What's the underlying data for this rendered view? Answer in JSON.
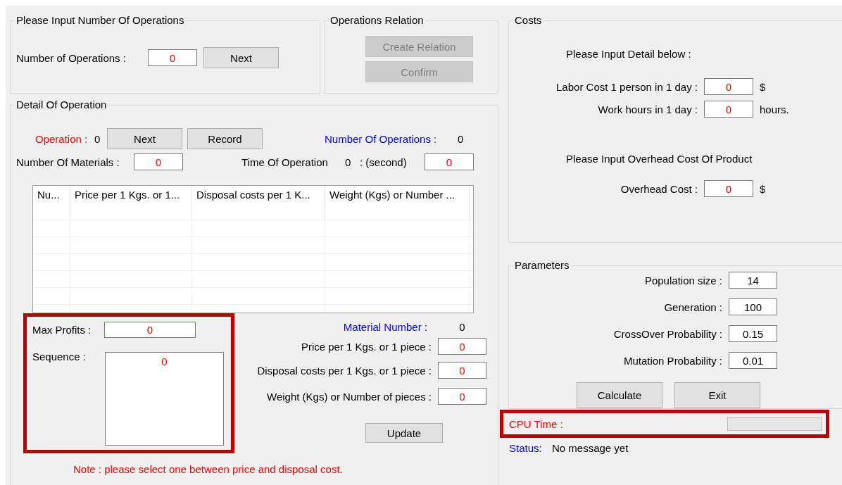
{
  "operations_input": {
    "title": "Please Input Number Of Operations",
    "label": "Number of Operations :",
    "value": "0",
    "next_button": "Next"
  },
  "operations_relation": {
    "title": "Operations Relation",
    "buttons": [
      {
        "label": "Create Relation",
        "disabled": true
      },
      {
        "label": "Confirm",
        "disabled": true
      }
    ]
  },
  "detail": {
    "title": "Detail Of Operation",
    "operation_label": "Operation :",
    "operation_value": "0",
    "buttons": [
      "Next",
      "Record"
    ],
    "count_label": "Number Of Operations :",
    "count_value": "0",
    "materials_label": "Number Of  Materials :",
    "materials_value": "0",
    "time_label": "Time Of Operation",
    "time_value": "0",
    "time_unit": ": (second)",
    "time_input": "0",
    "table": {
      "columns": [
        "Nu...",
        "Price per 1 Kgs. or 1...",
        "Disposal costs per 1 K...",
        "Weight (Kgs) or Number ..."
      ]
    },
    "max_profits": {
      "label": "Max Profits :",
      "value": "0"
    },
    "sequence": {
      "label": "Sequence  :",
      "value": "0"
    },
    "material_number": {
      "label": "Material Number :",
      "value": "0"
    },
    "material_fields": [
      {
        "label": "Price per 1 Kgs. or 1 piece :",
        "value": "0"
      },
      {
        "label": "Disposal costs per 1 Kgs. or 1 piece :",
        "value": "0"
      },
      {
        "label": "Weight (Kgs) or Number of pieces :",
        "value": "0"
      }
    ],
    "update_button": "Update",
    "note": "Note : please select one between price and disposal cost."
  },
  "costs": {
    "title": "Costs",
    "intro": "Please Input Detail below :",
    "labor_fields": [
      {
        "label": "Labor Cost  1 person in 1 day :",
        "value": "0",
        "unit": "$"
      },
      {
        "label": "Work hours in 1 day :",
        "value": "0",
        "unit": "hours."
      }
    ],
    "overhead_intro": "Please Input Overhead Cost Of Product",
    "overhead_field": {
      "label": "Overhead Cost :",
      "value": "0",
      "unit": "$"
    }
  },
  "parameters": {
    "title": "Parameters",
    "fields": [
      {
        "label": "Population size :",
        "value": "14"
      },
      {
        "label": "Generation  :",
        "value": "100"
      },
      {
        "label": "CrossOver Probability :",
        "value": "0.15"
      },
      {
        "label": "Mutation Probability :",
        "value": "0.01"
      }
    ],
    "buttons": [
      "Calculate",
      "Exit"
    ]
  },
  "cpu_time": {
    "label": "CPU Time :",
    "level": 0
  },
  "status": {
    "label": "Status:",
    "message": "No message yet"
  }
}
